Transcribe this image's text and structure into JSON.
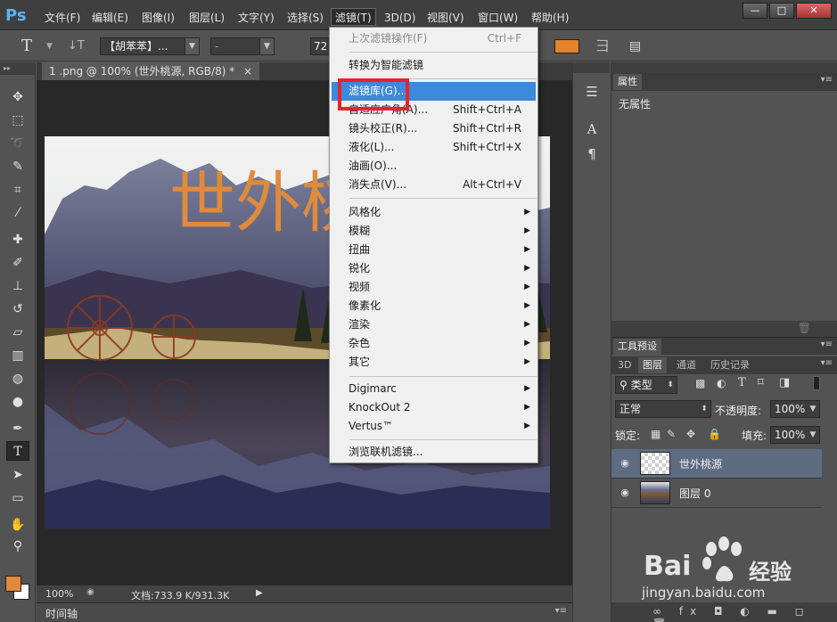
{
  "app": {
    "logo": "Ps",
    "menu": [
      "文件(F)",
      "编辑(E)",
      "图像(I)",
      "图层(L)",
      "文字(Y)",
      "选择(S)",
      "滤镜(T)",
      "3D(D)",
      "视图(V)",
      "窗口(W)",
      "帮助(H)"
    ],
    "active_menu_index": 6,
    "window_buttons": [
      "—",
      "□",
      "✕"
    ]
  },
  "options": {
    "tool_glyph": "T",
    "orient_glyph": "↓T",
    "font_family": "【胡苯苯】...",
    "font_style": "-",
    "font_size": "72",
    "text_color": "#e5822c"
  },
  "document": {
    "tab_title": "1 .png @ 100% (世外桃源, RGB/8) *",
    "tab_close": "×",
    "overlay_text": "世外桃",
    "overlay_color": "#e08a3c",
    "zoom": "100%",
    "doc_info": "文档:733.9 K/931.3K",
    "timeline": "时间轴"
  },
  "filter_menu": {
    "items": [
      {
        "label": "上次滤镜操作(F)",
        "shortcut": "Ctrl+F",
        "disabled": true,
        "sub": false
      },
      {
        "sep": true
      },
      {
        "label": "转换为智能滤镜",
        "shortcut": "",
        "sub": false
      },
      {
        "sep": true
      },
      {
        "label": "滤镜库(G)...",
        "shortcut": "",
        "sub": false,
        "highlight": true
      },
      {
        "label": "自适应广角(A)...",
        "shortcut": "Shift+Ctrl+A",
        "sub": false
      },
      {
        "label": "镜头校正(R)...",
        "shortcut": "Shift+Ctrl+R",
        "sub": false
      },
      {
        "label": "液化(L)...",
        "shortcut": "Shift+Ctrl+X",
        "sub": false
      },
      {
        "label": "油画(O)...",
        "shortcut": "",
        "sub": false
      },
      {
        "label": "消失点(V)...",
        "shortcut": "Alt+Ctrl+V",
        "sub": false
      },
      {
        "sep": true
      },
      {
        "label": "风格化",
        "sub": true
      },
      {
        "label": "模糊",
        "sub": true
      },
      {
        "label": "扭曲",
        "sub": true
      },
      {
        "label": "锐化",
        "sub": true
      },
      {
        "label": "视频",
        "sub": true
      },
      {
        "label": "像素化",
        "sub": true
      },
      {
        "label": "渲染",
        "sub": true
      },
      {
        "label": "杂色",
        "sub": true
      },
      {
        "label": "其它",
        "sub": true
      },
      {
        "sep": true
      },
      {
        "label": "Digimarc",
        "sub": true
      },
      {
        "label": "KnockOut 2",
        "sub": true
      },
      {
        "label": "Vertus™",
        "sub": true
      },
      {
        "sep": true
      },
      {
        "label": "浏览联机滤镜...",
        "sub": false
      }
    ]
  },
  "properties": {
    "tab": "属性",
    "body_text": "无属性"
  },
  "tool_presets": {
    "tab": "工具预设"
  },
  "layers": {
    "tabs": [
      "3D",
      "图层",
      "通道",
      "历史记录"
    ],
    "active_tab": 1,
    "filter_kind": "类型",
    "blend_mode": "正常",
    "opacity_label": "不透明度:",
    "opacity_value": "100%",
    "lock_label": "锁定:",
    "fill_label": "填充:",
    "fill_value": "100%",
    "rows": [
      {
        "name": "世外桃源",
        "selected": true,
        "kind": "text"
      },
      {
        "name": "图层 0",
        "selected": false,
        "kind": "image"
      }
    ],
    "footer_icons": "∞ fx ◘ ◐ ▬ ◻ 🗑"
  },
  "watermark": {
    "brand": "Bai",
    "brand_suffix": "经验",
    "url": "jingyan.baidu.com"
  }
}
